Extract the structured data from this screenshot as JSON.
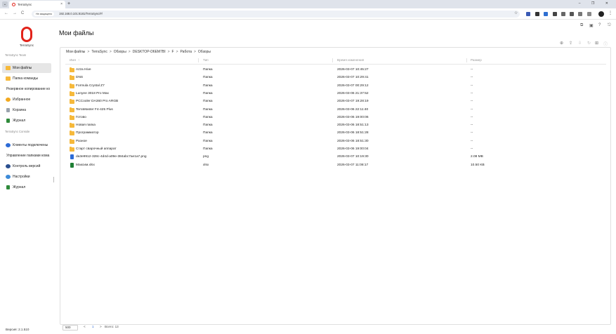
{
  "browser": {
    "tab_title": "TerraSync",
    "tab_close": "×",
    "new_tab": "+",
    "menu_glyph": "⌄",
    "window_controls": "– ❐ ✕",
    "back": "←",
    "forward": "→",
    "reload": "C",
    "insecure_label": "Не защищено",
    "url": "192.168.0.101:8181/TerraSync/#/",
    "star": "☆",
    "kebab": "⋮"
  },
  "sidebar": {
    "logo_text": "TerraSync",
    "team_section": "TerraSync Team",
    "team_items": [
      {
        "label": "Мои файлы",
        "icon": "folder-icon",
        "active": true
      },
      {
        "label": "Папка команды",
        "icon": "folder-icon",
        "active": false
      },
      {
        "label": "Резервное копирование ко",
        "icon": "",
        "active": false
      },
      {
        "label": "Избранное",
        "icon": "star-icon",
        "active": false
      },
      {
        "label": "Корзина",
        "icon": "trash-icon",
        "active": false
      },
      {
        "label": "Журнал",
        "icon": "log-icon",
        "active": false
      }
    ],
    "console_section": "TerraSync Console",
    "console_items": [
      {
        "label": "Клиенты подключены",
        "icon": "clients-icon"
      },
      {
        "label": "Управление папками кома",
        "icon": ""
      },
      {
        "label": "Контроль версий",
        "icon": "version-icon"
      },
      {
        "label": "Настройки",
        "icon": "settings-icon"
      },
      {
        "label": "Журнал",
        "icon": "log-icon"
      }
    ],
    "version": "Версия: 2.1.510"
  },
  "main": {
    "title": "Мои файлы",
    "top_icons": [
      "⧉",
      "▣",
      "?",
      "⎋"
    ],
    "toolbar_icons": [
      "⊕",
      "⇪",
      "⇩",
      "↻",
      "⊞",
      "ⓘ"
    ],
    "breadcrumb": [
      "Мои файлы",
      "TerraSync",
      "Обзоры",
      "DESKTOP-D6EM7BI",
      "F",
      "Работа",
      "Обзоры"
    ],
    "breadcrumb_sep": ">",
    "columns": {
      "name": "Имя",
      "sort_arrow": "↑",
      "type": "Тип",
      "time": "Время изменения",
      "size": "Размер"
    },
    "rows": [
      {
        "name": "Azza Hive",
        "type": "Папка",
        "time": "2026-03-07 10:45:27",
        "size": "--",
        "kind": "folder"
      },
      {
        "name": "DNS",
        "type": "Папка",
        "time": "2026-03-07 10:29:41",
        "size": "--",
        "kind": "folder"
      },
      {
        "name": "Formula Crystal Z7",
        "type": "Папка",
        "time": "2026-03-07 00:29:12",
        "size": "--",
        "kind": "folder"
      },
      {
        "name": "Lunyee 3018 Pro Max",
        "type": "Папка",
        "time": "2026-03-06 21:37:52",
        "size": "--",
        "kind": "folder"
      },
      {
        "name": "PCCooler DA360 Pro ARGB",
        "type": "Папка",
        "time": "2026-03-07 19:28:19",
        "size": "--",
        "kind": "folder"
      },
      {
        "name": "TerraMaster F4-425 Plus",
        "type": "Папка",
        "time": "2026-03-06 22:11:40",
        "size": "--",
        "kind": "folder"
      },
      {
        "name": "Готово",
        "type": "Папка",
        "time": "2026-03-06 19:00:06",
        "size": "--",
        "kind": "folder"
      },
      {
        "name": "Новая папка",
        "type": "Папка",
        "time": "2026-03-06 18:51:13",
        "size": "--",
        "kind": "folder"
      },
      {
        "name": "Программатор",
        "type": "Папка",
        "time": "2026-03-06 18:51:28",
        "size": "--",
        "kind": "folder"
      },
      {
        "name": "Разное",
        "type": "Папка",
        "time": "2026-03-06 18:51:30",
        "size": "--",
        "kind": "folder"
      },
      {
        "name": "Старт сварочный аппарат",
        "type": "Папка",
        "time": "2026-03-06 19:00:04",
        "size": "--",
        "kind": "folder"
      },
      {
        "name": "da3e9912-328c-4d4d-a09e-384abc7ae1a7.png",
        "type": "png",
        "time": "2026-03-07 10:19:30",
        "size": "2.08 MB",
        "kind": "png"
      },
      {
        "name": "Максим.xlsx",
        "type": "xlsx",
        "time": "2026-03-07 11:08:17",
        "size": "10.50 KB",
        "kind": "xlsx"
      }
    ],
    "pager": {
      "page_size": "500",
      "prev": "<",
      "page": "1",
      "next": ">",
      "total": "Всего: 13"
    }
  }
}
